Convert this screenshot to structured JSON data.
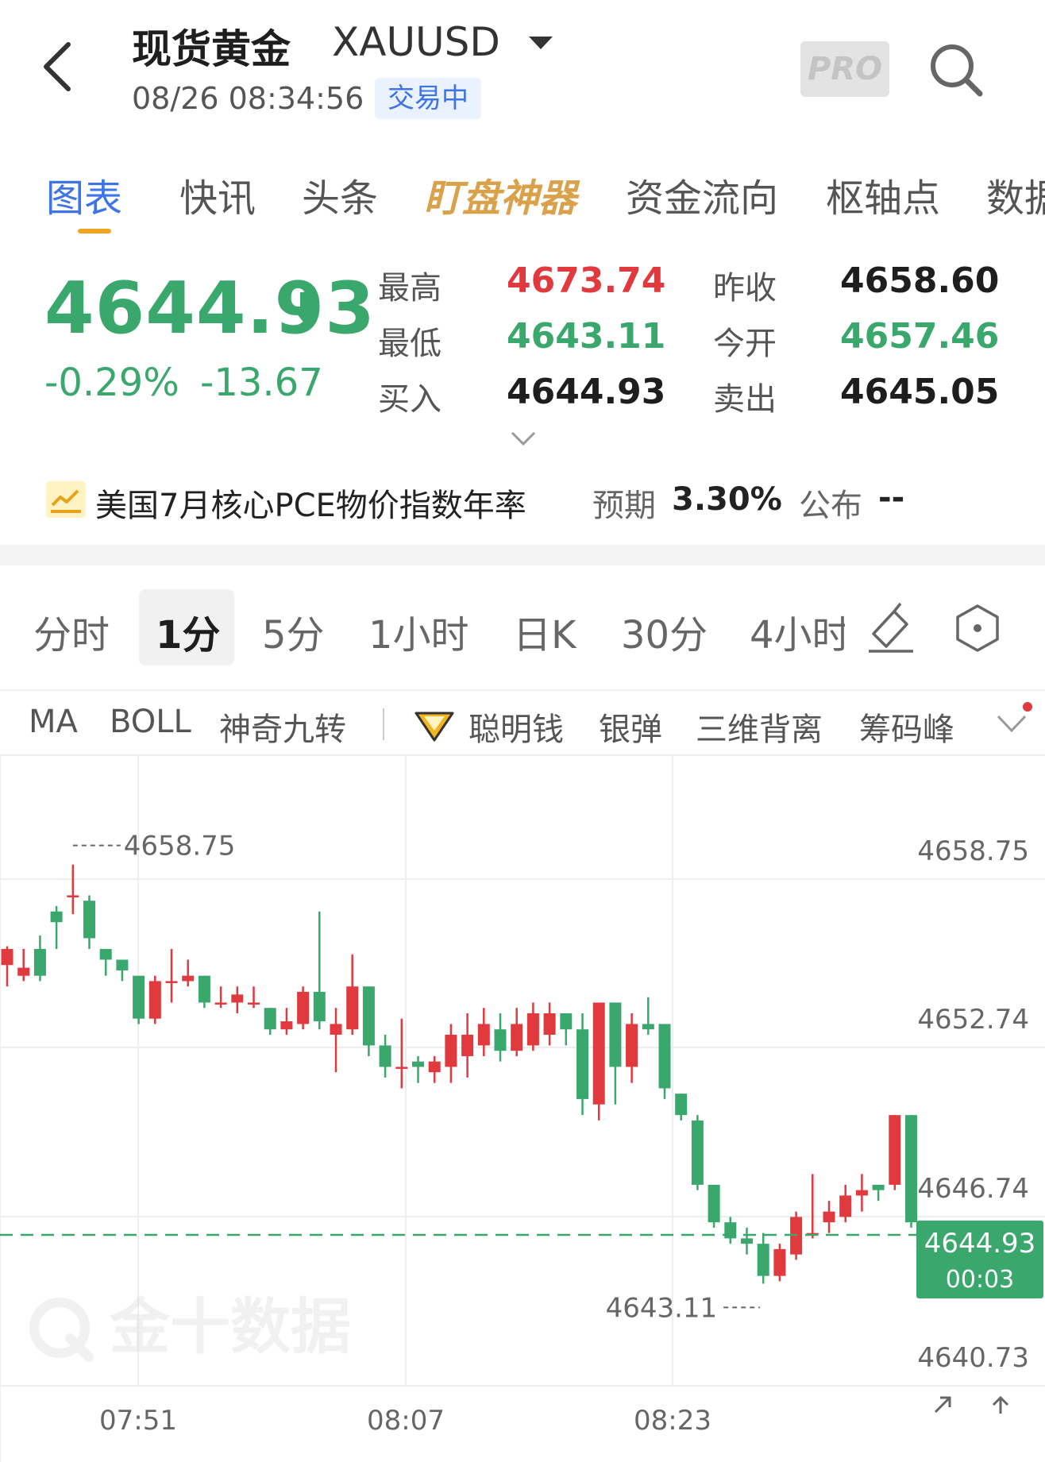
{
  "header": {
    "title": "现货黄金",
    "symbol": "XAUUSD",
    "timestamp": "08/26 08:34:56",
    "status": "交易中",
    "pro_label": "PRO"
  },
  "tabs": [
    {
      "label": "图表"
    },
    {
      "label": "快讯"
    },
    {
      "label": "头条"
    },
    {
      "label": "盯盘神器"
    },
    {
      "label": "资金流向"
    },
    {
      "label": "枢轴点"
    },
    {
      "label": "数据"
    }
  ],
  "quote": {
    "last": "4644.93",
    "change_pct": "-0.29%",
    "change_abs": "-13.67",
    "high_label": "最高",
    "high": "4673.74",
    "low_label": "最低",
    "low": "4643.11",
    "bid_label": "买入",
    "bid": "4644.93",
    "prev_close_label": "昨收",
    "prev_close": "4658.60",
    "open_label": "今开",
    "open": "4657.46",
    "ask_label": "卖出",
    "ask": "4645.05"
  },
  "event": {
    "title": "美国7月核心PCE物价指数年率",
    "expected_label": "预期",
    "expected": "3.30%",
    "published_label": "公布",
    "published": "--"
  },
  "periods": [
    {
      "label": "分时"
    },
    {
      "label": "1分"
    },
    {
      "label": "5分"
    },
    {
      "label": "1小时"
    },
    {
      "label": "日K"
    },
    {
      "label": "30分"
    },
    {
      "label": "4小时"
    }
  ],
  "indicators": [
    {
      "label": "MA"
    },
    {
      "label": "BOLL"
    },
    {
      "label": "神奇九转"
    },
    {
      "label": "聪明钱"
    },
    {
      "label": "银弹"
    },
    {
      "label": "三维背离"
    },
    {
      "label": "筹码峰"
    }
  ],
  "watermark": "金十数据",
  "colors": {
    "up": "#e0393e",
    "down": "#3aa76d",
    "accent": "#3d74e8",
    "tab_underline": "#f0a520"
  },
  "icons": [
    "back-icon",
    "dropdown-caret-icon",
    "search-icon",
    "down-arrow-icon",
    "expand-chevron-icon",
    "chart-trend-icon",
    "draw-tool-icon",
    "settings-hexagon-icon",
    "diamond-icon",
    "more-chevron-icon",
    "arrow-up-right-icon",
    "arrow-up-icon"
  ],
  "chart_data": {
    "type": "candlestick",
    "interval": "1分",
    "y_ticks": [
      "4658.75",
      "4652.74",
      "4646.74",
      "4640.73"
    ],
    "x_ticks": [
      "07:51",
      "08:07",
      "08:23"
    ],
    "ylim": [
      4639.3,
      4662.8
    ],
    "max_label": "4658.75",
    "min_label": "4643.11",
    "current_price": "4644.93",
    "current_countdown": "00:03",
    "candles": [
      [
        4655.0,
        4655.7,
        4654.2,
        4655.6
      ],
      [
        4654.6,
        4655.6,
        4654.4,
        4654.9
      ],
      [
        4655.6,
        4656.1,
        4654.4,
        4654.6
      ],
      [
        4657.0,
        4657.2,
        4655.6,
        4656.6
      ],
      [
        4657.6,
        4658.75,
        4656.9,
        4657.6
      ],
      [
        4657.4,
        4657.6,
        4655.6,
        4656.0
      ],
      [
        4655.6,
        4655.6,
        4654.6,
        4655.2
      ],
      [
        4655.2,
        4655.2,
        4654.4,
        4654.8
      ],
      [
        4654.6,
        4654.6,
        4652.8,
        4653.0
      ],
      [
        4653.0,
        4654.6,
        4652.8,
        4654.4
      ],
      [
        4654.4,
        4655.6,
        4653.6,
        4654.4
      ],
      [
        4654.4,
        4655.2,
        4654.2,
        4654.6
      ],
      [
        4654.6,
        4654.6,
        4653.4,
        4653.6
      ],
      [
        4653.6,
        4654.2,
        4653.4,
        4653.6
      ],
      [
        4653.6,
        4654.2,
        4653.2,
        4653.9
      ],
      [
        4653.6,
        4654.2,
        4653.4,
        4653.6
      ],
      [
        4653.4,
        4653.4,
        4652.4,
        4652.6
      ],
      [
        4652.6,
        4653.4,
        4652.4,
        4652.9
      ],
      [
        4652.8,
        4654.2,
        4652.6,
        4654.0
      ],
      [
        4654.0,
        4657.0,
        4652.6,
        4652.9
      ],
      [
        4652.4,
        4653.4,
        4651.0,
        4652.8
      ],
      [
        4652.6,
        4655.4,
        4652.4,
        4654.2
      ],
      [
        4654.2,
        4654.2,
        4651.6,
        4652.0
      ],
      [
        4652.0,
        4652.4,
        4650.8,
        4651.2
      ],
      [
        4651.2,
        4653.0,
        4650.4,
        4651.2
      ],
      [
        4651.4,
        4651.6,
        4650.6,
        4651.2
      ],
      [
        4651.0,
        4651.6,
        4650.6,
        4651.4
      ],
      [
        4651.2,
        4652.8,
        4650.6,
        4652.4
      ],
      [
        4651.6,
        4653.2,
        4650.8,
        4652.4
      ],
      [
        4652.0,
        4653.4,
        4651.6,
        4652.8
      ],
      [
        4652.6,
        4653.2,
        4651.4,
        4651.8
      ],
      [
        4651.8,
        4653.4,
        4651.6,
        4652.8
      ],
      [
        4652.0,
        4653.6,
        4651.8,
        4653.2
      ],
      [
        4652.4,
        4653.6,
        4652.0,
        4653.2
      ],
      [
        4653.2,
        4653.2,
        4652.0,
        4652.6
      ],
      [
        4652.6,
        4653.2,
        4649.4,
        4650.0
      ],
      [
        4649.8,
        4653.6,
        4649.2,
        4653.6
      ],
      [
        4653.6,
        4653.6,
        4649.8,
        4651.2
      ],
      [
        4651.2,
        4653.2,
        4650.6,
        4652.8
      ],
      [
        4652.8,
        4653.8,
        4652.4,
        4652.6
      ],
      [
        4652.8,
        4652.8,
        4650.0,
        4650.4
      ],
      [
        4650.2,
        4650.2,
        4649.2,
        4649.4
      ],
      [
        4649.2,
        4649.4,
        4646.6,
        4646.8
      ],
      [
        4646.8,
        4646.8,
        4645.2,
        4645.4
      ],
      [
        4645.4,
        4645.6,
        4644.6,
        4644.8
      ],
      [
        4644.8,
        4645.2,
        4644.2,
        4644.6
      ],
      [
        4644.6,
        4645.0,
        4643.11,
        4643.4
      ],
      [
        4643.4,
        4644.6,
        4643.2,
        4644.4
      ],
      [
        4644.2,
        4645.8,
        4644.0,
        4645.6
      ],
      [
        4645.0,
        4647.2,
        4644.8,
        4645.0
      ],
      [
        4645.4,
        4646.2,
        4645.0,
        4645.8
      ],
      [
        4645.6,
        4646.8,
        4645.4,
        4646.4
      ],
      [
        4646.4,
        4647.2,
        4645.8,
        4646.6
      ],
      [
        4646.8,
        4646.8,
        4646.2,
        4646.6
      ],
      [
        4646.8,
        4649.4,
        4646.6,
        4649.4
      ],
      [
        4649.4,
        4649.4,
        4645.2,
        4645.4
      ],
      [
        4645.4,
        4645.4,
        4644.2,
        4644.8
      ]
    ]
  }
}
